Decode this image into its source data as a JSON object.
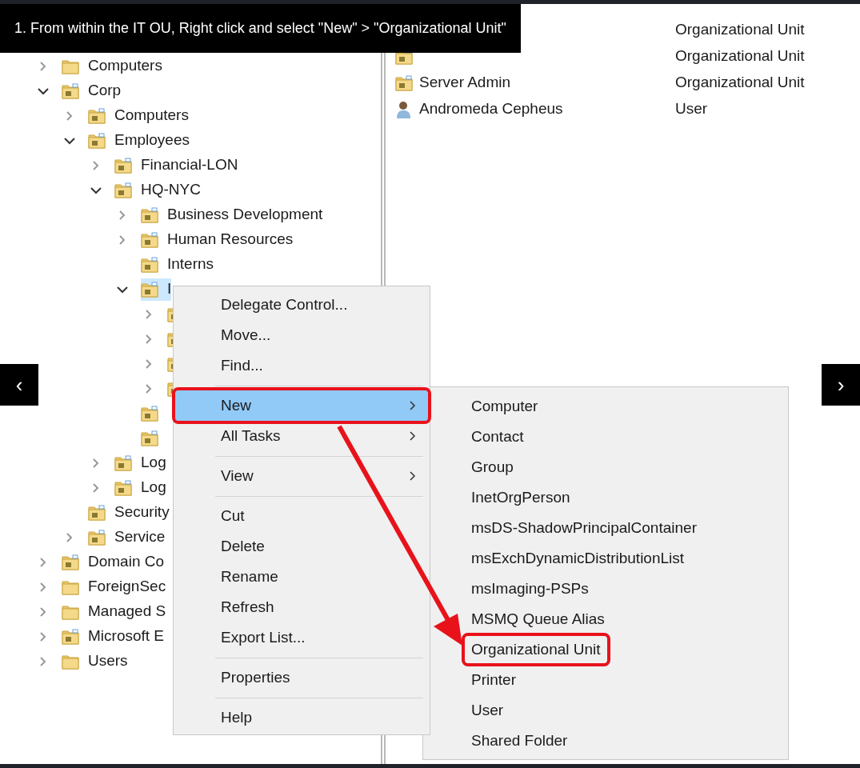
{
  "caption": "1. From within the IT OU, Right click and select \"New\" > \"Organizational Unit\"",
  "carousel": {
    "prev": "‹",
    "next": "›"
  },
  "tree": [
    {
      "label": "Computers",
      "kind": "folder",
      "expanded": false,
      "selected": false
    },
    {
      "label": "Corp",
      "kind": "ou",
      "expanded": true,
      "selected": false,
      "children": [
        {
          "label": "Computers",
          "kind": "ou",
          "expanded": false,
          "selected": false
        },
        {
          "label": "Employees",
          "kind": "ou",
          "expanded": true,
          "selected": false,
          "children": [
            {
              "label": "Financial-LON",
              "kind": "ou",
              "expanded": false,
              "selected": false
            },
            {
              "label": "HQ-NYC",
              "kind": "ou",
              "expanded": true,
              "selected": false,
              "children": [
                {
                  "label": "Business Development",
                  "kind": "ou",
                  "expanded": false,
                  "selected": false
                },
                {
                  "label": "Human Resources",
                  "kind": "ou",
                  "expanded": false,
                  "selected": false
                },
                {
                  "label": "Interns",
                  "kind": "ou",
                  "selected": false
                },
                {
                  "label": "I",
                  "kind": "ou",
                  "expanded": true,
                  "selected": true,
                  "children": [
                    {
                      "kind": "ou",
                      "expanded": false,
                      "selected": false
                    },
                    {
                      "kind": "ou",
                      "expanded": false,
                      "selected": false
                    },
                    {
                      "kind": "ou",
                      "expanded": false,
                      "selected": false
                    },
                    {
                      "kind": "ou",
                      "expanded": false,
                      "selected": false
                    }
                  ]
                },
                {
                  "kind": "ou",
                  "selected": false
                },
                {
                  "kind": "ou",
                  "selected": false
                }
              ]
            },
            {
              "label": "Log",
              "kind": "ou",
              "expanded": false,
              "selected": false
            },
            {
              "label": "Log",
              "kind": "ou",
              "expanded": false,
              "selected": false
            }
          ]
        },
        {
          "label": "Security",
          "kind": "ou",
          "selected": false
        },
        {
          "label": "Service",
          "kind": "ou",
          "expanded": false,
          "selected": false
        }
      ]
    },
    {
      "label": "Domain Co",
      "kind": "ou",
      "expanded": false,
      "selected": false
    },
    {
      "label": "ForeignSec",
      "kind": "folder",
      "expanded": false,
      "selected": false
    },
    {
      "label": "Managed S",
      "kind": "folder",
      "expanded": false,
      "selected": false
    },
    {
      "label": "Microsoft E",
      "kind": "ou",
      "expanded": false,
      "selected": false
    },
    {
      "label": "Users",
      "kind": "folder",
      "expanded": false,
      "selected": false
    }
  ],
  "list": {
    "rows": [
      {
        "type": "Organizational Unit"
      },
      {
        "kind": "ou",
        "type": "Organizational Unit"
      },
      {
        "kind": "ou",
        "name": "Server Admin",
        "type": "Organizational Unit"
      },
      {
        "kind": "user",
        "name": "Andromeda Cepheus",
        "type": "User"
      }
    ]
  },
  "context_menu": {
    "items": [
      {
        "kind": "item",
        "label": "Delegate Control...",
        "submenu": false,
        "hovered": false,
        "marked": false
      },
      {
        "kind": "item",
        "label": "Move...",
        "submenu": false,
        "hovered": false,
        "marked": false
      },
      {
        "kind": "item",
        "label": "Find...",
        "submenu": false,
        "hovered": false,
        "marked": false
      },
      {
        "kind": "separator"
      },
      {
        "kind": "item",
        "label": "New",
        "submenu": true,
        "hovered": true,
        "marked": true
      },
      {
        "kind": "item",
        "label": "All Tasks",
        "submenu": true,
        "hovered": false,
        "marked": false
      },
      {
        "kind": "separator"
      },
      {
        "kind": "item",
        "label": "View",
        "submenu": true,
        "hovered": false,
        "marked": false
      },
      {
        "kind": "separator"
      },
      {
        "kind": "item",
        "label": "Cut",
        "submenu": false,
        "hovered": false,
        "marked": false
      },
      {
        "kind": "item",
        "label": "Delete",
        "submenu": false,
        "hovered": false,
        "marked": false
      },
      {
        "kind": "item",
        "label": "Rename",
        "submenu": false,
        "hovered": false,
        "marked": false
      },
      {
        "kind": "item",
        "label": "Refresh",
        "submenu": false,
        "hovered": false,
        "marked": false
      },
      {
        "kind": "item",
        "label": "Export List...",
        "submenu": false,
        "hovered": false,
        "marked": false
      },
      {
        "kind": "separator"
      },
      {
        "kind": "item",
        "label": "Properties",
        "submenu": false,
        "hovered": false,
        "marked": false
      },
      {
        "kind": "separator"
      },
      {
        "kind": "item",
        "label": "Help",
        "submenu": false,
        "hovered": false,
        "marked": false
      }
    ]
  },
  "submenu": {
    "items": [
      {
        "label": "Computer",
        "marked": false
      },
      {
        "label": "Contact",
        "marked": false
      },
      {
        "label": "Group",
        "marked": false
      },
      {
        "label": "InetOrgPerson",
        "marked": false
      },
      {
        "label": "msDS-ShadowPrincipalContainer",
        "marked": false
      },
      {
        "label": "msExchDynamicDistributionList",
        "marked": false
      },
      {
        "label": "msImaging-PSPs",
        "marked": false
      },
      {
        "label": "MSMQ Queue Alias",
        "marked": false
      },
      {
        "label": "Organizational Unit",
        "marked": true
      },
      {
        "label": "Printer",
        "marked": false
      },
      {
        "label": "User",
        "marked": false
      },
      {
        "label": "Shared Folder",
        "marked": false
      }
    ]
  }
}
